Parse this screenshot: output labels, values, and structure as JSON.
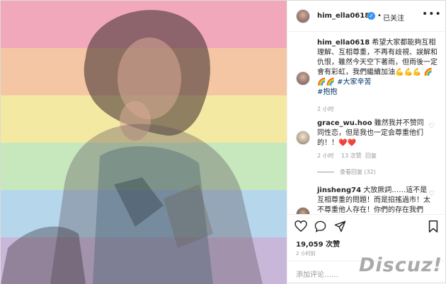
{
  "post": {
    "username": "him_ella0618",
    "follow_label": "已关注",
    "follow_dot": "•",
    "more_glyph": "•••",
    "caption": {
      "username": "him_ella0618",
      "text": "希望大家都能夠互相理解、互相尊重，不再有歧視、誤解和仇恨，雖然今天空下著雨，但雨後一定會有彩虹，我們繼續加油💪💪💪 🌈🌈🌈",
      "hashtag1": "#大家辛苦",
      "hashtag2": "#抱抱",
      "time": "2 小时"
    },
    "comments": [
      {
        "username": "grace_wu.hoo",
        "text": "雖然我并不赞同同性恋，但是我也一定会尊重他们的！！❤️❤️",
        "time": "2 小时",
        "likes": "13 次赞",
        "reply": "回复",
        "view_replies": "查看回复 (32)"
      },
      {
        "username": "jinsheng74",
        "text": "大放厥詞……這不是互相尊重的問題！而是招搖過市！太不尊重他人存在！你們的存在我們"
      }
    ],
    "likes": "19,059 次赞",
    "posted_time": "2 小时前",
    "add_comment_placeholder": "添加评论……",
    "colors": {
      "stripes": [
        "#f1a8ba",
        "#f4c6a4",
        "#f4e9a3",
        "#c7e8bd",
        "#b6d6ec",
        "#c9b7d9"
      ],
      "verified": "#3897f0",
      "hashtag": "#003569"
    }
  },
  "watermark": "Discuz!"
}
